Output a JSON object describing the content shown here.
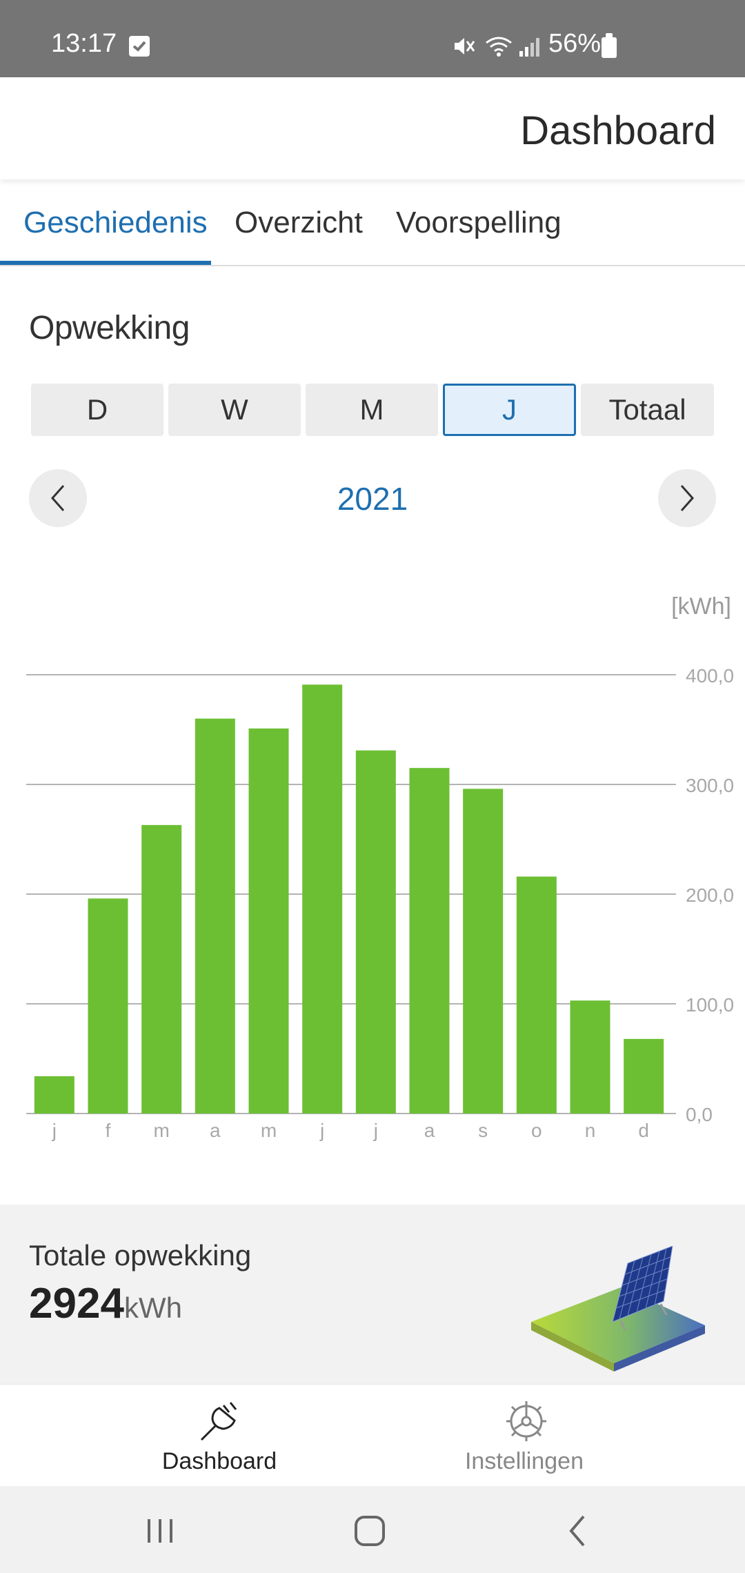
{
  "status_bar": {
    "time": "13:17",
    "battery": "56%"
  },
  "header": {
    "title": "Dashboard"
  },
  "tabs": [
    {
      "label": "Geschiedenis",
      "active": true
    },
    {
      "label": "Overzicht",
      "active": false
    },
    {
      "label": "Voorspelling",
      "active": false
    }
  ],
  "section": {
    "title": "Opwekking"
  },
  "periods": [
    {
      "label": "D",
      "active": false
    },
    {
      "label": "W",
      "active": false
    },
    {
      "label": "M",
      "active": false
    },
    {
      "label": "J",
      "active": true
    },
    {
      "label": "Totaal",
      "active": false
    }
  ],
  "year_nav": {
    "year": "2021",
    "prev_icon": "chevron-left-icon",
    "next_icon": "chevron-right-icon"
  },
  "chart_data": {
    "type": "bar",
    "unit_label": "[kWh]",
    "categories": [
      "j",
      "f",
      "m",
      "a",
      "m",
      "j",
      "j",
      "a",
      "s",
      "o",
      "n",
      "d"
    ],
    "values": [
      34,
      196,
      263,
      360,
      351,
      391,
      331,
      315,
      296,
      216,
      103,
      68
    ],
    "ylim": [
      0,
      400
    ],
    "yticks": [
      "0,0",
      "100,0",
      "200,0",
      "300,0",
      "400,0"
    ],
    "grid": true,
    "bar_color": "#6cbf33"
  },
  "totals": {
    "label": "Totale opwekking",
    "value": "2924",
    "unit": "kWh"
  },
  "bottom_nav": [
    {
      "label": "Dashboard",
      "icon": "plug-icon",
      "active": true
    },
    {
      "label": "Instellingen",
      "icon": "settings-gear-icon",
      "active": false
    }
  ],
  "colors": {
    "accent": "#1e6fb0",
    "bar": "#6cbf33",
    "statusbar": "#757575"
  }
}
